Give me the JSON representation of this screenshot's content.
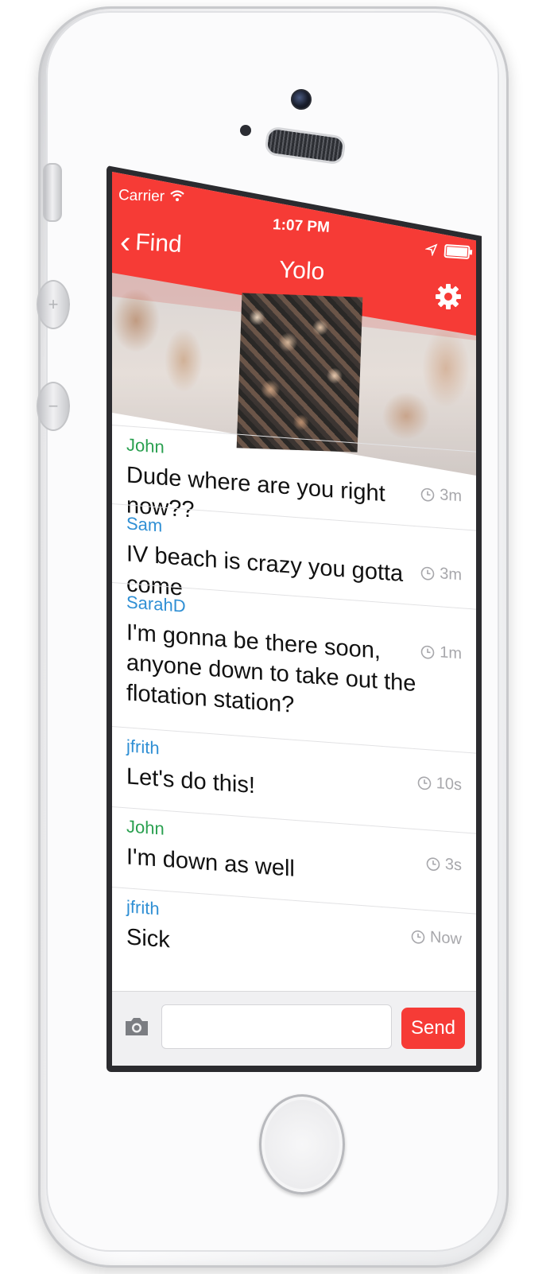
{
  "status_bar": {
    "carrier": "Carrier",
    "time": "1:07 PM"
  },
  "nav": {
    "back_label": "Find",
    "title": "Yolo"
  },
  "colors": {
    "accent": "#f63b36",
    "green_user": "#2aa050",
    "blue_user": "#2f8fd4"
  },
  "messages": [
    {
      "user": "John",
      "text": "Dude where are you right now??",
      "ago": "3m",
      "color": "green"
    },
    {
      "user": "Sam",
      "text": "IV beach is crazy you gotta come",
      "ago": "3m",
      "color": "blue"
    },
    {
      "user": "SarahD",
      "text": "I'm gonna be there soon, anyone down to take out the flotation station?",
      "ago": "1m",
      "color": "blue"
    },
    {
      "user": "jfrith",
      "text": "Let's do this!",
      "ago": "10s",
      "color": "blue"
    },
    {
      "user": "John",
      "text": "I'm down as well",
      "ago": "3s",
      "color": "green"
    },
    {
      "user": "jfrith",
      "text": "Sick",
      "ago": "Now",
      "color": "blue"
    }
  ],
  "composer": {
    "input_value": "",
    "send_label": "Send"
  }
}
